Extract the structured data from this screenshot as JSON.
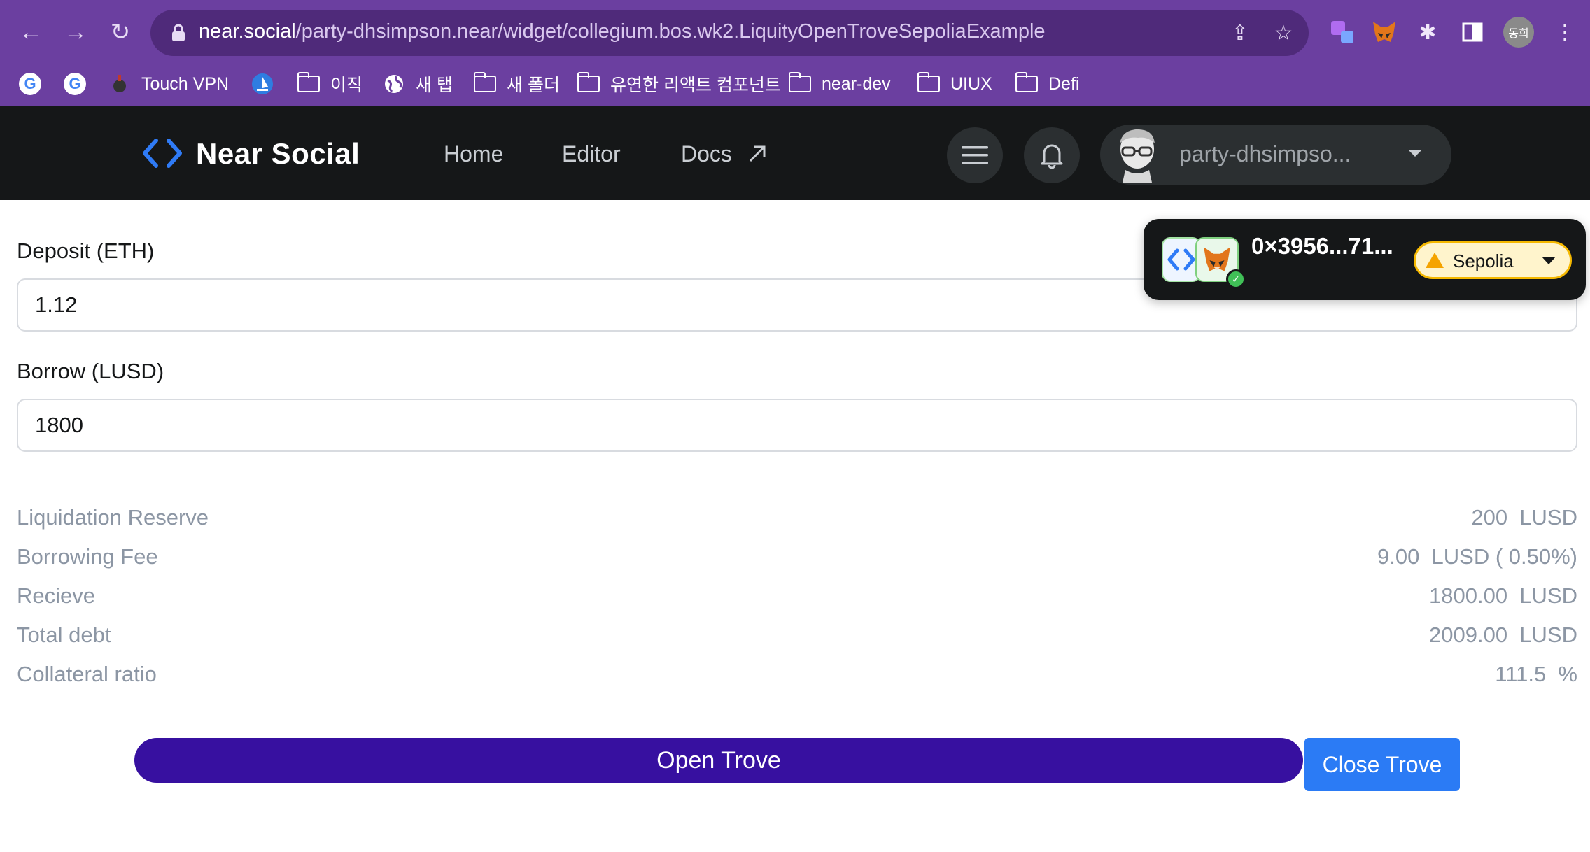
{
  "browser": {
    "url_host": "near.social",
    "url_path": "/party-dhsimpson.near/widget/collegium.bos.wk2.LiquityOpenTroveSepoliaExample",
    "profile_initials": "동희",
    "bookmarks": [
      {
        "label": "",
        "icon": "google-icon"
      },
      {
        "label": "",
        "icon": "google-icon"
      },
      {
        "label": "Touch VPN",
        "icon": "vpn-icon"
      },
      {
        "label": "",
        "icon": "sailboat-icon"
      },
      {
        "label": "이직",
        "icon": "folder-icon"
      },
      {
        "label": "새 탭",
        "icon": "globe-icon"
      },
      {
        "label": "새 폴더",
        "icon": "folder-icon"
      },
      {
        "label": "유연한 리액트 컴포넌트",
        "icon": "folder-icon"
      },
      {
        "label": "near-dev",
        "icon": "folder-icon"
      },
      {
        "label": "UIUX",
        "icon": "folder-icon"
      },
      {
        "label": "Defi",
        "icon": "folder-icon"
      }
    ]
  },
  "header": {
    "brand": "Near Social",
    "nav": {
      "home": "Home",
      "editor": "Editor",
      "docs": "Docs"
    },
    "account_name": "party-dhsimpso..."
  },
  "form": {
    "deposit_label": "Deposit (ETH)",
    "deposit_value": "1.12",
    "borrow_label": "Borrow (LUSD)",
    "borrow_value": "1800"
  },
  "stats": {
    "liquidation_reserve_label": "Liquidation Reserve",
    "liquidation_reserve_value": "200  LUSD",
    "borrowing_fee_label": "Borrowing Fee",
    "borrowing_fee_value": "9.00  LUSD ( 0.50%)",
    "receive_label": "Recieve",
    "receive_value": "1800.00  LUSD",
    "total_debt_label": "Total debt",
    "total_debt_value": "2009.00  LUSD",
    "collateral_ratio_label": "Collateral ratio",
    "collateral_ratio_value": "111.5  %"
  },
  "actions": {
    "open_trove": "Open Trove",
    "close_trove": "Close Trove"
  },
  "wallet": {
    "address": "0×3956...71...",
    "network": "Sepolia"
  },
  "colors": {
    "chrome": "#6b3fa0",
    "header_bg": "#151718",
    "open_button": "#3710a0",
    "close_button": "#2b7bf5"
  }
}
